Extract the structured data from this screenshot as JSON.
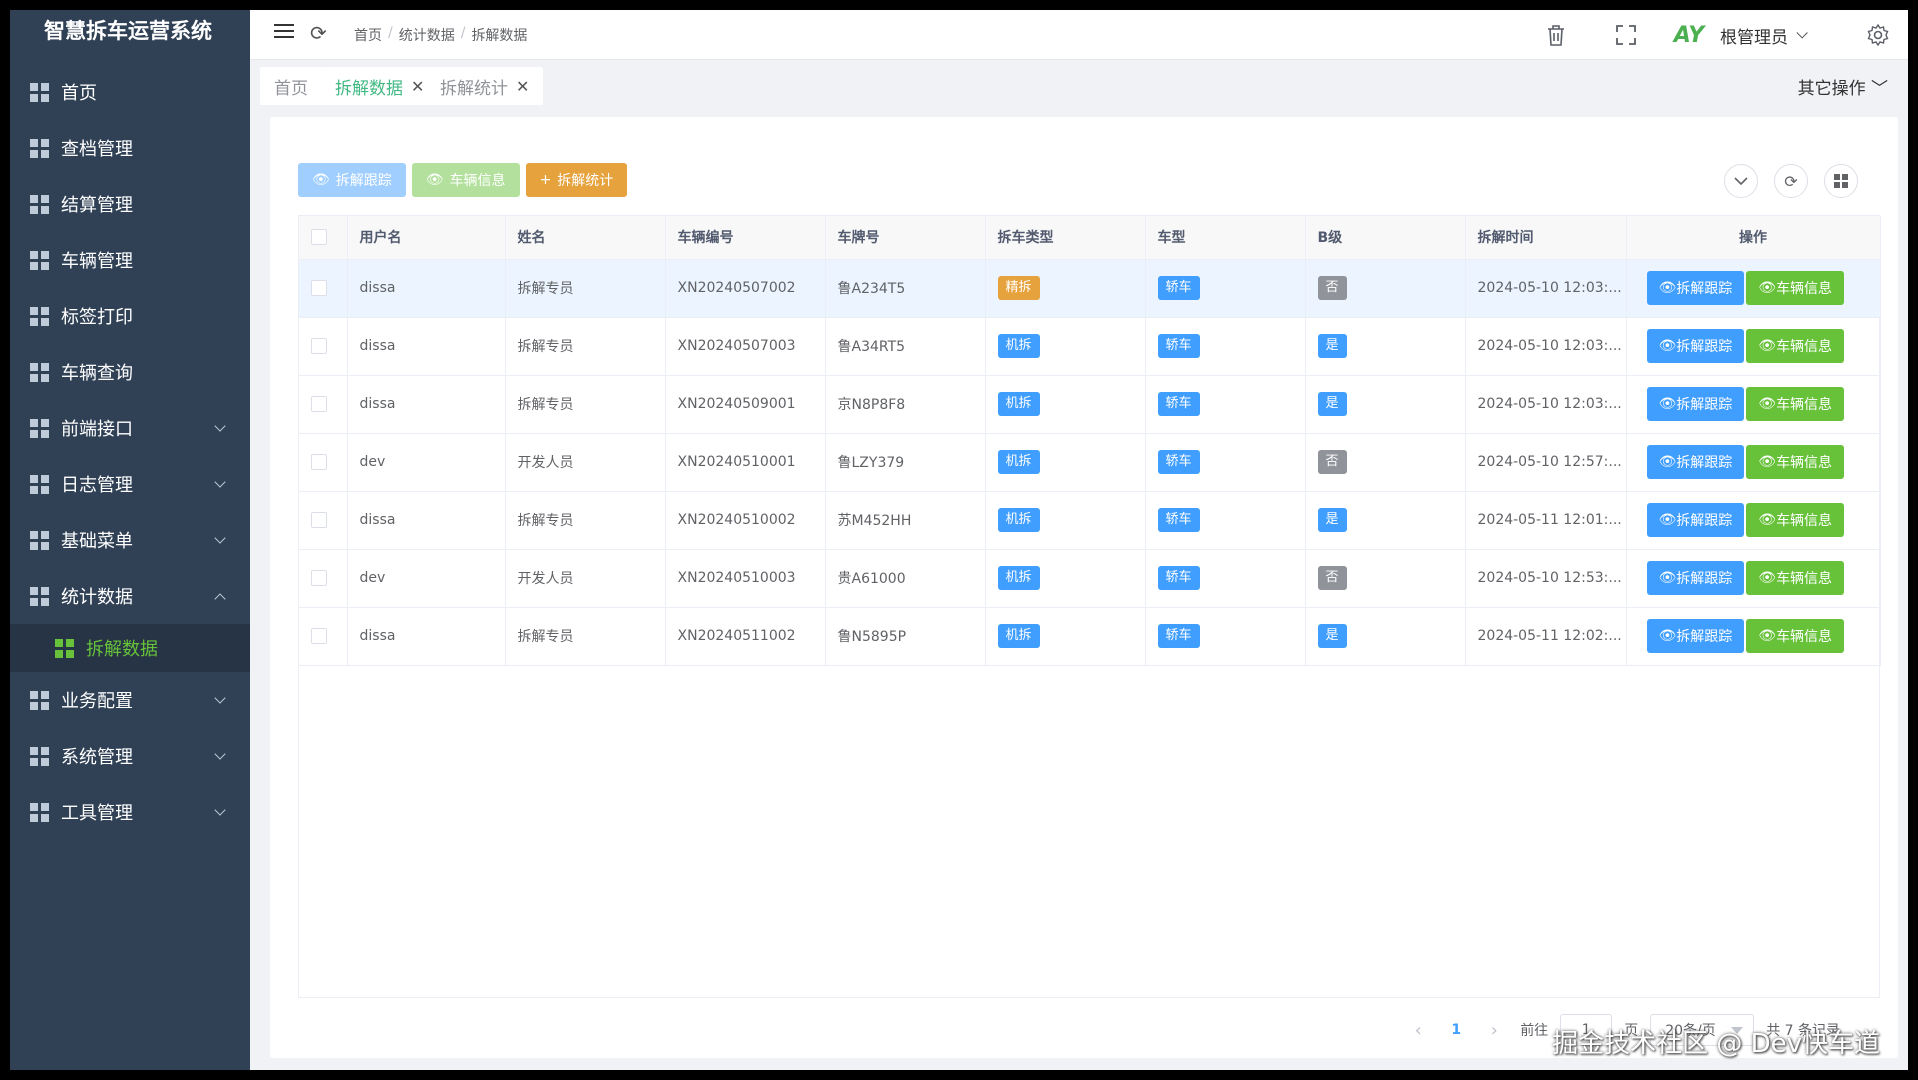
{
  "app": {
    "title": "智慧拆车运营系统"
  },
  "sidebar": {
    "items": [
      {
        "label": "首页",
        "expandable": false
      },
      {
        "label": "查档管理",
        "expandable": false
      },
      {
        "label": "结算管理",
        "expandable": false
      },
      {
        "label": "车辆管理",
        "expandable": false
      },
      {
        "label": "标签打印",
        "expandable": false
      },
      {
        "label": "车辆查询",
        "expandable": false
      },
      {
        "label": "前端接口",
        "expandable": true
      },
      {
        "label": "日志管理",
        "expandable": true
      },
      {
        "label": "基础菜单",
        "expandable": true
      },
      {
        "label": "统计数据",
        "expandable": true,
        "expanded": true
      },
      {
        "label": "业务配置",
        "expandable": true
      },
      {
        "label": "系统管理",
        "expandable": true
      },
      {
        "label": "工具管理",
        "expandable": true
      }
    ],
    "active_sub": "拆解数据"
  },
  "navbar": {
    "breadcrumb": [
      "首页",
      "统计数据",
      "拆解数据"
    ],
    "user": "根管理员",
    "avatar_text": "AY"
  },
  "tags": {
    "items": [
      "首页",
      "拆解数据",
      "拆解统计"
    ],
    "active": "拆解数据",
    "other_ops": "其它操作"
  },
  "toolbar": {
    "track_label": "拆解跟踪",
    "info_label": "车辆信息",
    "stat_label": "拆解统计"
  },
  "table": {
    "headers": [
      "用户名",
      "姓名",
      "车辆编号",
      "车牌号",
      "拆车类型",
      "车型",
      "B级",
      "拆解时间",
      "操作"
    ],
    "rows": [
      {
        "user": "dissa",
        "name": "拆解专员",
        "vehicle_no": "XN20240507002",
        "plate": "鲁A234T5",
        "type": "精拆",
        "model": "轿车",
        "b_level": "否",
        "time": "2024-05-10 12:03:..."
      },
      {
        "user": "dissa",
        "name": "拆解专员",
        "vehicle_no": "XN20240507003",
        "plate": "鲁A34RT5",
        "type": "机拆",
        "model": "轿车",
        "b_level": "是",
        "time": "2024-05-10 12:03:..."
      },
      {
        "user": "dissa",
        "name": "拆解专员",
        "vehicle_no": "XN20240509001",
        "plate": "京N8P8F8",
        "type": "机拆",
        "model": "轿车",
        "b_level": "是",
        "time": "2024-05-10 12:03:..."
      },
      {
        "user": "dev",
        "name": "开发人员",
        "vehicle_no": "XN20240510001",
        "plate": "鲁LZY379",
        "type": "机拆",
        "model": "轿车",
        "b_level": "否",
        "time": "2024-05-10 12:57:..."
      },
      {
        "user": "dissa",
        "name": "拆解专员",
        "vehicle_no": "XN20240510002",
        "plate": "苏M452HH",
        "type": "机拆",
        "model": "轿车",
        "b_level": "是",
        "time": "2024-05-11 12:01:..."
      },
      {
        "user": "dev",
        "name": "开发人员",
        "vehicle_no": "XN20240510003",
        "plate": "贵A61000",
        "type": "机拆",
        "model": "轿车",
        "b_level": "否",
        "time": "2024-05-10 12:53:..."
      },
      {
        "user": "dissa",
        "name": "拆解专员",
        "vehicle_no": "XN20240511002",
        "plate": "鲁N5895P",
        "type": "机拆",
        "model": "轿车",
        "b_level": "是",
        "time": "2024-05-11 12:02:..."
      }
    ],
    "op_track": "拆解跟踪",
    "op_info": "车辆信息"
  },
  "pagination": {
    "current_page": "1",
    "goto_label": "前往",
    "goto_value": "1",
    "page_unit": "页",
    "page_size": "20条/页",
    "total": "共 7 条记录"
  },
  "watermark": "掘金技术社区 @ Dev快车道",
  "colors": {
    "sidebar_bg": "#304156",
    "active_green": "#67c23a",
    "primary_blue": "#409eff",
    "warning_orange": "#e6a23c",
    "tag_active": "#42b983"
  }
}
